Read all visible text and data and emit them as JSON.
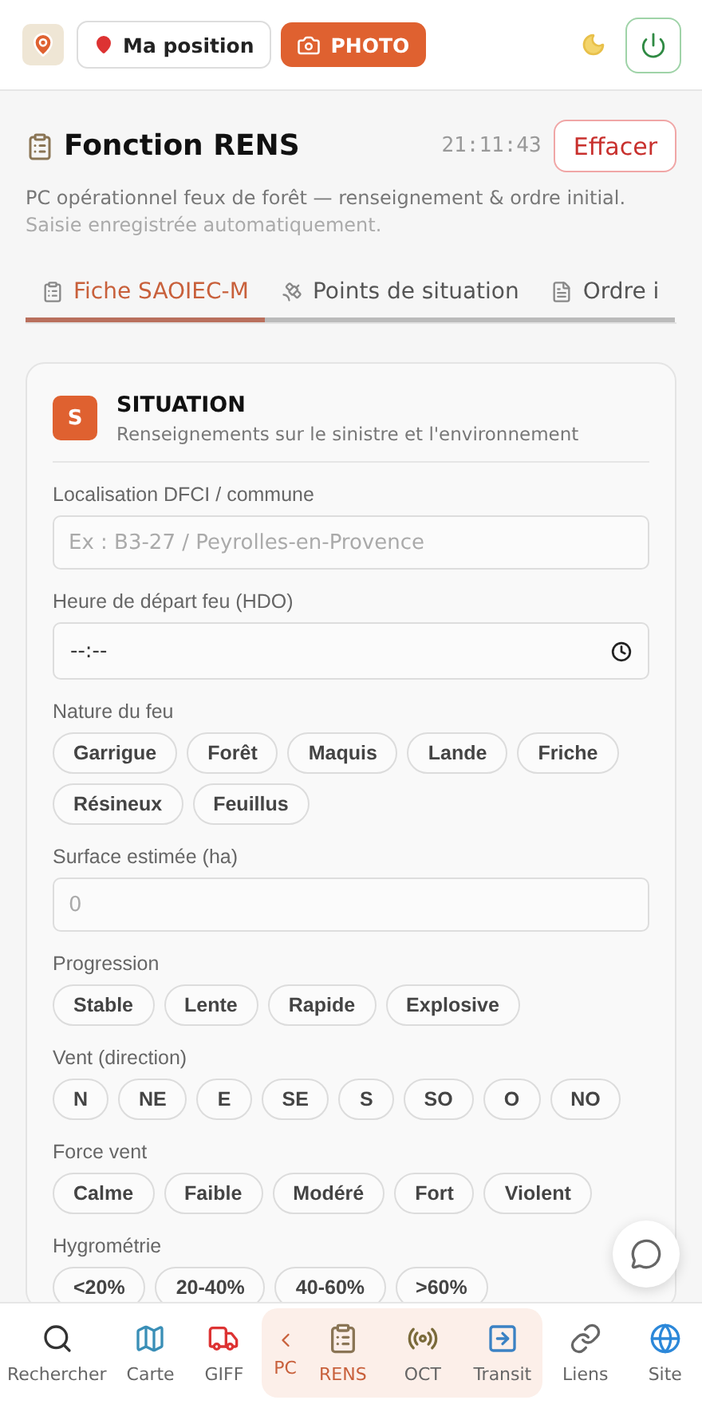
{
  "header": {
    "position_button": "Ma position",
    "photo_button": "PHOTO"
  },
  "title": "Fonction RENS",
  "time": "21:11:43",
  "clear_button": "Effacer",
  "description": {
    "main": "PC opérationnel feux de forêt — renseignement & ordre initial.",
    "note": "Saisie enregistrée automatiquement."
  },
  "tabs": [
    {
      "label": "Fiche SAOIEC-M",
      "selected": true
    },
    {
      "label": "Points de situation",
      "selected": false
    },
    {
      "label": "Ordre i",
      "selected": false
    }
  ],
  "section": {
    "letter": "S",
    "title": "SITUATION",
    "subtitle": "Renseignements sur le sinistre et l'environnement"
  },
  "fields": [
    {
      "kind": "text",
      "label": "Localisation DFCI / commune",
      "placeholder": "Ex : B3-27 / Peyrolles-en-Provence"
    },
    {
      "kind": "time",
      "label": "Heure de départ feu (HDO)",
      "value": "--:--"
    },
    {
      "kind": "chips",
      "label": "Nature du feu",
      "options": [
        {
          "label": "Garrigue",
          "selected": false
        },
        {
          "label": "Forêt",
          "selected": false
        },
        {
          "label": "Maquis",
          "selected": false
        },
        {
          "label": "Lande",
          "selected": false
        },
        {
          "label": "Friche",
          "selected": false
        },
        {
          "label": "Résineux",
          "selected": false
        },
        {
          "label": "Feuillus",
          "selected": false
        }
      ]
    },
    {
      "kind": "text",
      "label": "Surface estimée (ha)",
      "placeholder": "0"
    },
    {
      "kind": "chips",
      "label": "Progression",
      "options": [
        {
          "label": "Stable",
          "selected": false
        },
        {
          "label": "Lente",
          "selected": false
        },
        {
          "label": "Rapide",
          "selected": false
        },
        {
          "label": "Explosive",
          "selected": false
        }
      ]
    },
    {
      "kind": "chips",
      "label": "Vent (direction)",
      "options": [
        {
          "label": "N",
          "selected": false
        },
        {
          "label": "NE",
          "selected": false
        },
        {
          "label": "E",
          "selected": false
        },
        {
          "label": "SE",
          "selected": false
        },
        {
          "label": "S",
          "selected": false
        },
        {
          "label": "SO",
          "selected": false
        },
        {
          "label": "O",
          "selected": false
        },
        {
          "label": "NO",
          "selected": false
        }
      ]
    },
    {
      "kind": "chips",
      "label": "Force vent",
      "options": [
        {
          "label": "Calme",
          "selected": false
        },
        {
          "label": "Faible",
          "selected": false
        },
        {
          "label": "Modéré",
          "selected": false
        },
        {
          "label": "Fort",
          "selected": false
        },
        {
          "label": "Violent",
          "selected": false
        }
      ]
    },
    {
      "kind": "chips",
      "label": "Hygrométrie",
      "options": [
        {
          "label": "<20%",
          "selected": false
        },
        {
          "label": "20-40%",
          "selected": false
        },
        {
          "label": "40-60%",
          "selected": false
        },
        {
          "label": ">60%",
          "selected": false
        }
      ]
    }
  ],
  "bottom_nav": [
    {
      "kind": "item",
      "label": "Rechercher",
      "selected": false
    },
    {
      "kind": "item",
      "label": "Carte",
      "selected": false
    },
    {
      "kind": "item",
      "label": "GIFF",
      "selected": false
    },
    {
      "kind": "group",
      "label": "PC",
      "items": [
        {
          "kind": "item",
          "label": "RENS",
          "selected": true
        },
        {
          "kind": "item",
          "label": "OCT",
          "selected": false
        },
        {
          "kind": "item",
          "label": "Transit",
          "selected": false
        }
      ]
    },
    {
      "kind": "item",
      "label": "Liens",
      "selected": false
    },
    {
      "kind": "item",
      "label": "Site",
      "selected": false
    }
  ]
}
